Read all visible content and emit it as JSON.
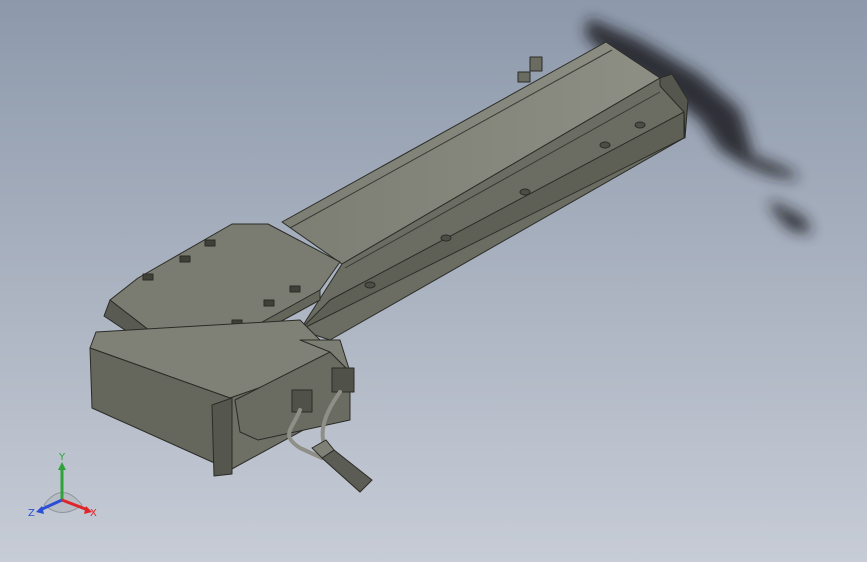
{
  "viewport": {
    "background_top": "#8d99ab",
    "background_bottom": "#c7ccd6"
  },
  "model": {
    "body_color": "#6f7266",
    "top_color": "#85877b",
    "side_color": "#5a5c52",
    "edge_color": "#2b2c27",
    "shadow_color": "#1d1f24",
    "cable_color": "#8e8f86"
  },
  "triad": {
    "x_label": "X",
    "y_label": "Y",
    "z_label": "Z",
    "x_color": "#e0242a",
    "y_color": "#2fa33a",
    "z_color": "#2a4fd6"
  }
}
